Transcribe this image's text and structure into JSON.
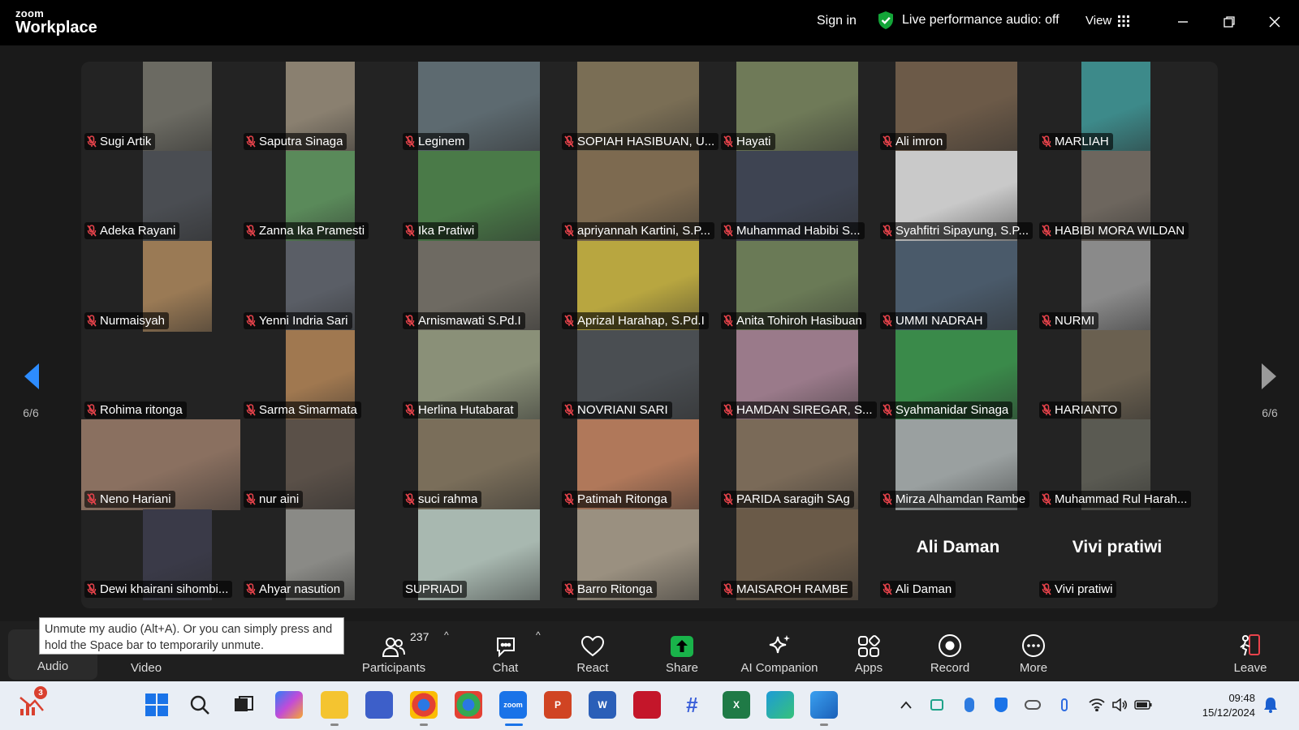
{
  "titlebar": {
    "logo_small": "zoom",
    "logo_large": "Workplace",
    "signin": "Sign in",
    "live_audio": "Live performance audio: off",
    "view": "View"
  },
  "pager": {
    "left": "6/6",
    "right": "6/6"
  },
  "participants_grid": [
    {
      "name": "Sugi Artik",
      "muted": true,
      "has_video": true
    },
    {
      "name": "Saputra Sinaga",
      "muted": true,
      "has_video": true
    },
    {
      "name": "Leginem",
      "muted": true,
      "has_video": true
    },
    {
      "name": "SOPIAH HASIBUAN, U...",
      "muted": true,
      "has_video": true
    },
    {
      "name": "Hayati",
      "muted": true,
      "has_video": true
    },
    {
      "name": "Ali imron",
      "muted": true,
      "has_video": true
    },
    {
      "name": "MARLIAH",
      "muted": true,
      "has_video": true
    },
    {
      "name": "Adeka Rayani",
      "muted": true,
      "has_video": true
    },
    {
      "name": "Zanna Ika Pramesti",
      "muted": true,
      "has_video": true
    },
    {
      "name": "Ika Pratiwi",
      "muted": true,
      "has_video": true
    },
    {
      "name": "apriyannah Kartini, S.P...",
      "muted": true,
      "has_video": true
    },
    {
      "name": "Muhammad Habibi S...",
      "muted": true,
      "has_video": true
    },
    {
      "name": "Syahfitri Sipayung, S.P...",
      "muted": true,
      "has_video": true
    },
    {
      "name": "HABIBI MORA WILDAN",
      "muted": true,
      "has_video": true
    },
    {
      "name": "Nurmaisyah",
      "muted": true,
      "has_video": true
    },
    {
      "name": "Yenni Indria Sari",
      "muted": true,
      "has_video": true
    },
    {
      "name": "Arnismawati S.Pd.I",
      "muted": true,
      "has_video": true
    },
    {
      "name": "Aprizal Harahap, S.Pd.I",
      "muted": true,
      "has_video": true
    },
    {
      "name": "Anita Tohiroh Hasibuan",
      "muted": true,
      "has_video": true
    },
    {
      "name": "UMMI NADRAH",
      "muted": true,
      "has_video": true
    },
    {
      "name": "NURMI",
      "muted": true,
      "has_video": true
    },
    {
      "name": "Rohima ritonga",
      "muted": true,
      "has_video": false
    },
    {
      "name": "Sarma Simarmata",
      "muted": true,
      "has_video": true
    },
    {
      "name": "Herlina Hutabarat",
      "muted": true,
      "has_video": true
    },
    {
      "name": "NOVRIANI SARI",
      "muted": true,
      "has_video": true
    },
    {
      "name": "HAMDAN SIREGAR, S...",
      "muted": true,
      "has_video": true
    },
    {
      "name": "Syahmanidar Sinaga",
      "muted": true,
      "has_video": true
    },
    {
      "name": "HARIANTO",
      "muted": true,
      "has_video": true
    },
    {
      "name": "Neno Hariani",
      "muted": true,
      "has_video": true
    },
    {
      "name": "nur aini",
      "muted": true,
      "has_video": true
    },
    {
      "name": "suci rahma",
      "muted": true,
      "has_video": true
    },
    {
      "name": "Patimah Ritonga",
      "muted": true,
      "has_video": true
    },
    {
      "name": "PARIDA saragih SAg",
      "muted": true,
      "has_video": true
    },
    {
      "name": "Mirza Alhamdan Rambe",
      "muted": true,
      "has_video": true
    },
    {
      "name": "Muhammad Rul Harah...",
      "muted": true,
      "has_video": true
    },
    {
      "name": "Dewi khairani sihombi...",
      "muted": true,
      "has_video": true
    },
    {
      "name": "Ahyar nasution",
      "muted": true,
      "has_video": true
    },
    {
      "name": "SUPRIADI",
      "muted": false,
      "has_video": true
    },
    {
      "name": "Barro Ritonga",
      "muted": true,
      "has_video": true
    },
    {
      "name": "MAISAROH RAMBE",
      "muted": true,
      "has_video": true
    },
    {
      "name": "Ali Daman",
      "muted": true,
      "has_video": false,
      "big_label": "Ali Daman"
    },
    {
      "name": "Vivi pratiwi",
      "muted": true,
      "has_video": false,
      "big_label": "Vivi pratiwi"
    }
  ],
  "tile_colors": [
    "#6b6a62",
    "#8a8070",
    "#5d6a70",
    "#7a6e55",
    "#6f7a58",
    "#6c5a48",
    "#3d8a8a",
    "#4a4d52",
    "#5a8a5a",
    "#4a7a48",
    "#7d6a50",
    "#3e4452",
    "#c9c9c9",
    "#6d665e",
    "#9a7a55",
    "#5a5e66",
    "#6e6a62",
    "#b8a640",
    "#6a7a56",
    "#4a5a6a",
    "#8a8a8a",
    "#232323",
    "#a07850",
    "#8a9078",
    "#4a4e52",
    "#9a7a8a",
    "#3a8a4a",
    "#6a6050",
    "#8a7060",
    "#5a5048",
    "#7a6e5a",
    "#b0785a",
    "#7a6a58",
    "#9aa0a0",
    "#5a5a52",
    "#3a3a48",
    "#8a8a86",
    "#a8b8b0",
    "#9a9080",
    "#6a5a48",
    "#232323",
    "#232323"
  ],
  "tooltip": "Unmute my audio (Alt+A). Or you can simply press and hold the Space bar to temporarily unmute.",
  "toolbar": {
    "audio": "Audio",
    "video": "Video",
    "participants": "Participants",
    "participants_count": "237",
    "chat": "Chat",
    "react": "React",
    "share": "Share",
    "ai_companion": "AI Companion",
    "apps": "Apps",
    "record": "Record",
    "more": "More",
    "leave": "Leave"
  },
  "taskbar": {
    "badge": "3",
    "zoom_label": "zoom",
    "time": "09:48",
    "date": "15/12/2024"
  },
  "colors": {
    "accent_green": "#13a538",
    "mute_red": "#e8434b",
    "share_green": "#19b34a",
    "pager_blue": "#2d8cff"
  }
}
